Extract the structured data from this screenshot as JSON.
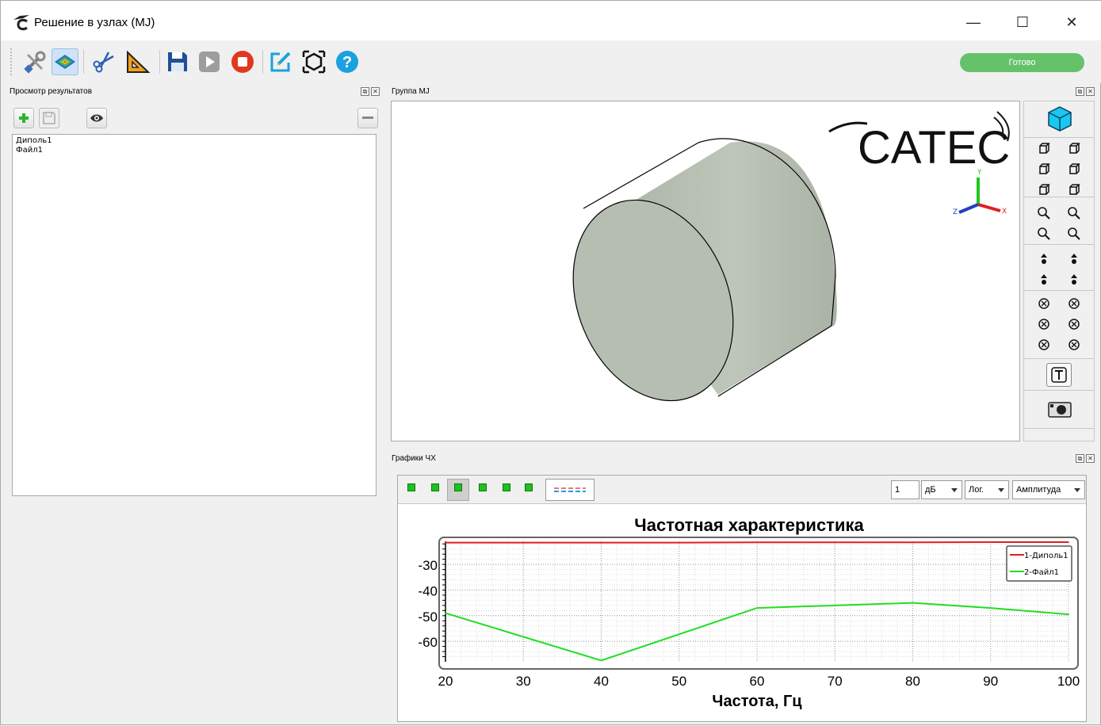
{
  "window": {
    "title": "Решение в узлах (MJ)",
    "minimize": "—",
    "maximize": "☐",
    "close": "✕"
  },
  "toolbar": {
    "status": "Готово",
    "icons": [
      "tools-icon",
      "mesh-view-icon",
      "scissors-icon",
      "ruler-icon",
      "save-icon",
      "run-icon",
      "stop-icon",
      "edit-icon",
      "target-icon",
      "help-icon"
    ]
  },
  "left_dock": {
    "title": "Просмотр результатов",
    "items": [
      "Диполь1",
      "Файл1"
    ]
  },
  "view_dock": {
    "title": "Группа MJ",
    "logo": "CATEC",
    "axis_labels": {
      "y": "Y",
      "x": "X",
      "z": "Z"
    }
  },
  "chart_dock": {
    "title": "Графики ЧХ",
    "value_input": "1",
    "unit_select": "дБ",
    "scale_select": "Лог.",
    "mode_select": "Амплитуда"
  },
  "colors": {
    "status_green": "#65c26a",
    "series1": "#e02020",
    "series2": "#22dd22",
    "cylinder": "#b8c0b4"
  },
  "chart_data": {
    "type": "line",
    "title": "Частотная характеристика",
    "xlabel": "Частота, Гц",
    "ylabel": "",
    "xlim": [
      20,
      100
    ],
    "ylim": [
      -68,
      -21
    ],
    "x_ticks": [
      20,
      30,
      40,
      50,
      60,
      70,
      80,
      90,
      100
    ],
    "y_ticks": [
      -30,
      -40,
      -50,
      -60
    ],
    "grid": true,
    "legend_position": "top-right",
    "series": [
      {
        "name": "1-Диполь1",
        "color": "#e02020",
        "x": [
          20,
          30,
          40,
          50,
          60,
          70,
          80,
          90,
          100
        ],
        "y": [
          -21.5,
          -21.5,
          -21.5,
          -21.5,
          -21.4,
          -21.4,
          -21.4,
          -21.3,
          -21.3
        ]
      },
      {
        "name": "2-Файл1",
        "color": "#22dd22",
        "x": [
          20,
          40,
          60,
          70,
          80,
          90,
          100
        ],
        "y": [
          -49,
          -67.5,
          -47,
          -46,
          -45,
          -47,
          -49.5
        ]
      }
    ]
  }
}
